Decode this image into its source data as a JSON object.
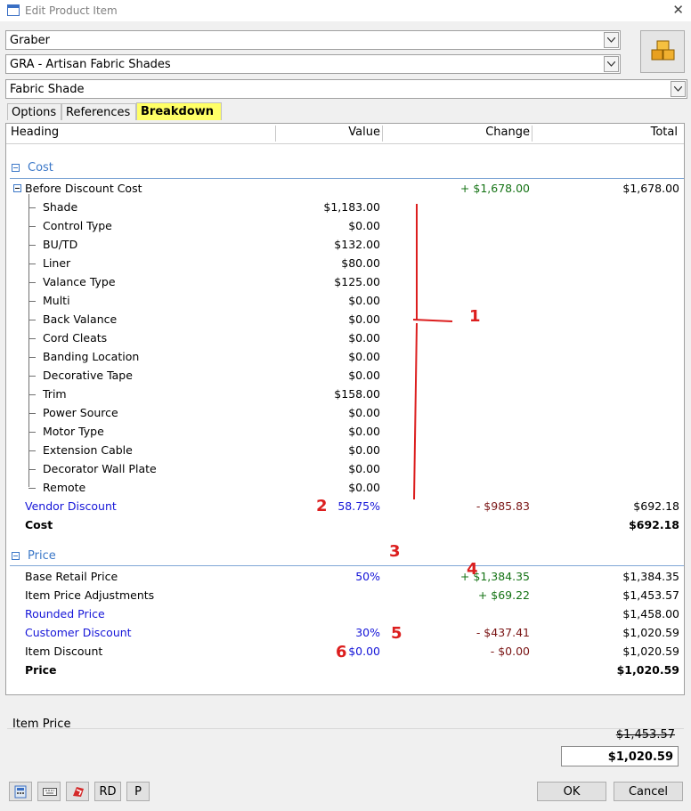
{
  "window": {
    "title": "Edit Product Item",
    "close_glyph": "✕"
  },
  "selectors": {
    "vendor": "Graber",
    "product_line": "GRA - Artisan Fabric Shades",
    "product_type": "Fabric Shade"
  },
  "tabs": [
    {
      "label": "Options"
    },
    {
      "label": "References"
    },
    {
      "label": "Breakdown",
      "active": true
    }
  ],
  "table": {
    "headers": {
      "heading": "Heading",
      "value": "Value",
      "change": "Change",
      "total": "Total"
    },
    "cost_section": {
      "title": "Cost",
      "before_discount": {
        "label": "Before Discount Cost",
        "change": "+ $1,678.00",
        "total": "$1,678.00"
      },
      "items": [
        {
          "label": "Shade",
          "value": "$1,183.00"
        },
        {
          "label": "Control Type",
          "value": "$0.00"
        },
        {
          "label": "BU/TD",
          "value": "$132.00"
        },
        {
          "label": "Liner",
          "value": "$80.00"
        },
        {
          "label": "Valance Type",
          "value": "$125.00"
        },
        {
          "label": "Multi",
          "value": "$0.00"
        },
        {
          "label": "Back Valance",
          "value": "$0.00"
        },
        {
          "label": "Cord Cleats",
          "value": "$0.00"
        },
        {
          "label": "Banding Location",
          "value": "$0.00"
        },
        {
          "label": "Decorative Tape",
          "value": "$0.00"
        },
        {
          "label": "Trim",
          "value": "$158.00"
        },
        {
          "label": "Power Source",
          "value": "$0.00"
        },
        {
          "label": "Motor Type",
          "value": "$0.00"
        },
        {
          "label": "Extension Cable",
          "value": "$0.00"
        },
        {
          "label": "Decorator Wall Plate",
          "value": "$0.00"
        },
        {
          "label": "Remote",
          "value": "$0.00"
        }
      ],
      "vendor_discount": {
        "label": "Vendor Discount",
        "value": "58.75%",
        "change": "-  $985.83",
        "total": "$692.18"
      },
      "cost_total": {
        "label": "Cost",
        "total": "$692.18"
      }
    },
    "price_section": {
      "title": "Price",
      "rows": [
        {
          "label": "Base Retail Price",
          "value": "50%",
          "change": "+ $1,384.35",
          "total": "$1,384.35",
          "label_color": "black",
          "change_color": "green"
        },
        {
          "label": "Item Price Adjustments",
          "value": "",
          "change": "+ $69.22",
          "total": "$1,453.57",
          "label_color": "black",
          "change_color": "green"
        },
        {
          "label": "Rounded Price",
          "value": "",
          "change": "",
          "total": "$1,458.00",
          "label_color": "blue",
          "change_color": "green"
        },
        {
          "label": "Customer Discount",
          "value": "30%",
          "change": "-  $437.41",
          "total": "$1,020.59",
          "label_color": "blue",
          "change_color": "maroon"
        },
        {
          "label": "Item Discount",
          "value": "$0.00",
          "change": "-  $0.00",
          "total": "$1,020.59",
          "label_color": "black",
          "change_color": "maroon"
        }
      ],
      "price_total": {
        "label": "Price",
        "total": "$1,020.59"
      }
    }
  },
  "annotations": [
    "1",
    "2",
    "3",
    "4",
    "5",
    "6"
  ],
  "item_price": {
    "label": "Item Price",
    "old": "$1,453.57",
    "new": "$1,020.59"
  },
  "footer": {
    "icons": [
      "calculator-icon",
      "keyboard-icon",
      "brand-icon"
    ],
    "rd_label": "RD",
    "p_label": "P",
    "ok_label": "OK",
    "cancel_label": "Cancel"
  },
  "colors": {
    "accent_blue": "#1515d8",
    "section_blue": "#3c78c8",
    "annotation_red": "#dc1e1e",
    "tab_highlight": "#ffff66",
    "change_green": "#157315",
    "change_maroon": "#7a1515"
  }
}
